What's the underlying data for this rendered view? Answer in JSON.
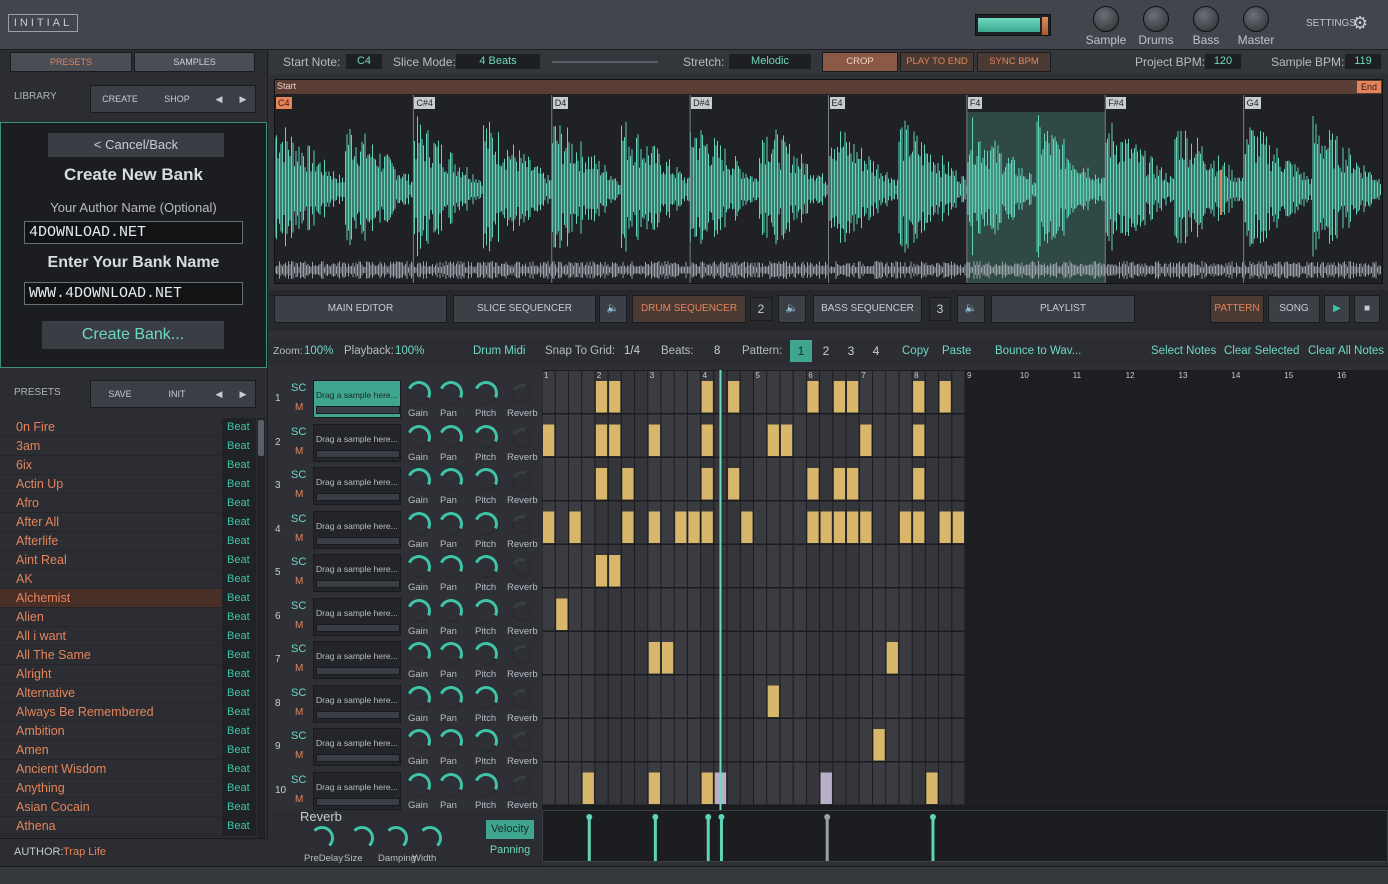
{
  "header": {
    "logo": "INITIAL",
    "knobs": [
      "Sample",
      "Drums",
      "Bass",
      "Master"
    ],
    "settings": "SETTINGS"
  },
  "left": {
    "tabs": {
      "presets": "PRESETS",
      "samples": "SAMPLES"
    },
    "library": {
      "label": "LIBRARY",
      "create": "CREATE",
      "shop": "SHOP",
      "prev": "◀",
      "next": "▶"
    },
    "form": {
      "cancel": "< Cancel/Back",
      "title": "Create New Bank",
      "author_label": "Your Author Name (Optional)",
      "author_value": "4DOWNLOAD.NET",
      "bank_label": "Enter Your Bank Name",
      "bank_value": "WWW.4DOWNLOAD.NET",
      "create": "Create Bank..."
    },
    "presets": {
      "label": "PRESETS",
      "save": "SAVE",
      "init": "INIT",
      "prev": "◀",
      "next": "▶"
    },
    "preset_items": [
      "0n Fire",
      "3am",
      "6ix",
      "Actin Up",
      "Afro",
      "After All",
      "Afterlife",
      "Aint Real",
      "AK",
      "Alchemist",
      "Alien",
      "All i want",
      "All The Same",
      "Alright",
      "Alternative",
      "Always Be Remembered",
      "Ambition",
      "Amen",
      "Ancient Wisdom",
      "Anything",
      "Asian Cocain",
      "Athena"
    ],
    "preset_tag": "Beat",
    "selected_index": 9,
    "author": {
      "label": "AUTHOR:",
      "value": "Trap Life"
    }
  },
  "topbar": {
    "start_note_label": "Start Note:",
    "start_note": "C4",
    "slice_mode_label": "Slice Mode:",
    "slice_mode": "4 Beats",
    "stretch_label": "Stretch:",
    "stretch": "Melodic",
    "crop": "CROP",
    "play_to_end": "PLAY TO END",
    "sync_bpm": "SYNC BPM",
    "project_bpm_label": "Project BPM:",
    "project_bpm": "120",
    "sample_bpm_label": "Sample BPM:",
    "sample_bpm": "119"
  },
  "waveform": {
    "start": "Start",
    "end": "End",
    "notes": [
      "C4",
      "C#4",
      "D4",
      "D#4",
      "E4",
      "F4",
      "F#4",
      "G4"
    ],
    "selected_slice": 5
  },
  "editor_tabs": {
    "main": "MAIN EDITOR",
    "slice": "SLICE SEQUENCER",
    "drum": "DRUM SEQUENCER",
    "drum_num": "2",
    "bass": "BASS SEQUENCER",
    "bass_num": "3",
    "playlist": "PLAYLIST",
    "pattern": "PATTERN",
    "song": "SONG",
    "play": "▶",
    "stop": "■"
  },
  "seq_toolbar": {
    "zoom_label": "Zoom:",
    "zoom": "100%",
    "playback_label": "Playback:",
    "playback": "100%",
    "drum_midi": "Drum Midi",
    "snap_label": "Snap To Grid:",
    "snap": "1/4",
    "beats_label": "Beats:",
    "beats": "8",
    "pattern_label": "Pattern:",
    "patterns": [
      "1",
      "2",
      "3",
      "4"
    ],
    "active_pattern": 0,
    "copy": "Copy",
    "paste": "Paste",
    "bounce": "Bounce to Wav...",
    "select_notes": "Select Notes",
    "clear_selected": "Clear Selected",
    "clear_all": "Clear All Notes"
  },
  "tracks": {
    "sc": "SC",
    "m": "M",
    "slot_text": "Drag a sample here...",
    "knobs": [
      "Gain",
      "Pan",
      "Pitch",
      "Reverb"
    ],
    "numbers": [
      "1",
      "2",
      "3",
      "4",
      "5",
      "6",
      "7",
      "8",
      "9",
      "10"
    ]
  },
  "grid": {
    "bar_numbers": [
      "1",
      "2",
      "3",
      "4",
      "5",
      "6",
      "7",
      "8",
      "9",
      "10",
      "11",
      "12",
      "13",
      "14",
      "15",
      "16"
    ],
    "active_steps": 32,
    "total_steps": 64,
    "playhead_step": 13.5,
    "notes": [
      [
        4,
        5,
        12,
        14,
        20,
        22,
        23,
        28,
        30
      ],
      [
        0,
        4,
        5,
        8,
        12,
        17,
        18,
        24,
        28
      ],
      [
        4,
        6,
        12,
        14,
        20,
        22,
        23,
        28
      ],
      [
        0,
        2,
        6,
        8,
        10,
        11,
        12,
        15,
        20,
        21,
        22,
        23,
        24,
        27,
        28,
        30,
        31
      ],
      [
        4,
        5
      ],
      [
        1
      ],
      [
        8,
        9,
        26
      ],
      [
        17
      ],
      [
        25
      ],
      [
        3,
        8,
        12,
        13,
        21,
        29
      ]
    ],
    "ghost_notes": [
      [
        9,
        13
      ],
      [
        9,
        21
      ]
    ],
    "colors": {
      "note": "#d8b76a",
      "ghost": "#b8b0c8",
      "playhead": "#6fd8c0"
    }
  },
  "reverb": {
    "title": "Reverb",
    "knobs": [
      "PreDelay",
      "Size",
      "Damping",
      "Width"
    ]
  },
  "velocity": {
    "velocity": "Velocity",
    "panning": "Panning",
    "lanes": [
      3,
      8,
      12,
      13,
      21,
      29
    ]
  }
}
